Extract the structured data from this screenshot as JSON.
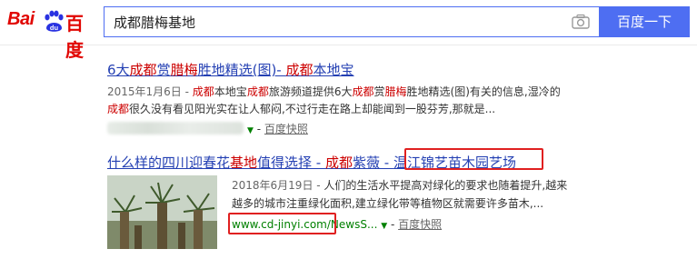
{
  "logo": {
    "bai": "Bai",
    "du_paw": "du",
    "du": "百度"
  },
  "search": {
    "query": "成都腊梅基地",
    "button": "百度一下"
  },
  "results": [
    {
      "title": {
        "p1": "6大",
        "p2": "成都",
        "p3": "赏",
        "p4": "腊梅",
        "p5": "胜地精选(图)- ",
        "p6": "成都",
        "p7": "本地宝"
      },
      "abstract1": {
        "date": "2015年1月6日 - ",
        "a": "成都",
        "b": "本地宝",
        "c": "成都",
        "d": "旅游频道提供6大",
        "e": "成都",
        "f": "赏",
        "g": "腊梅",
        "h": "胜地精选(图)有关的信息,湿冷的"
      },
      "abstract2": {
        "a": "成都",
        "b": "很久没有看见阳光实在让人郁闷,不过行走在路上却能闻到一股芬芳,那就是..."
      },
      "snapshot": "百度快照"
    },
    {
      "title": {
        "p1": "什么样的四川迎春花",
        "p2": "基地",
        "p3": "值得选择 - ",
        "p4": "成都",
        "p5": "紫薇 - ",
        "p6": "温江锦艺苗木园艺场"
      },
      "abstract1": {
        "date": "2018年6月19日 - ",
        "text": "人们的生活水平提高对绿化的要求也随着提升,越来"
      },
      "abstract2": "越多的城市注重绿化面积,建立绿化带等植物区就需要许多苗木,...",
      "url": "www.cd-jinyi.com/NewsS...",
      "snapshot": "百度快照"
    }
  ],
  "colors": {
    "brand_red": "#e10602",
    "search_blue": "#4e6ef2",
    "link": "#2440b3",
    "highlight": "#c00000",
    "url_green": "#008000",
    "annotation_box": "#e02020"
  }
}
